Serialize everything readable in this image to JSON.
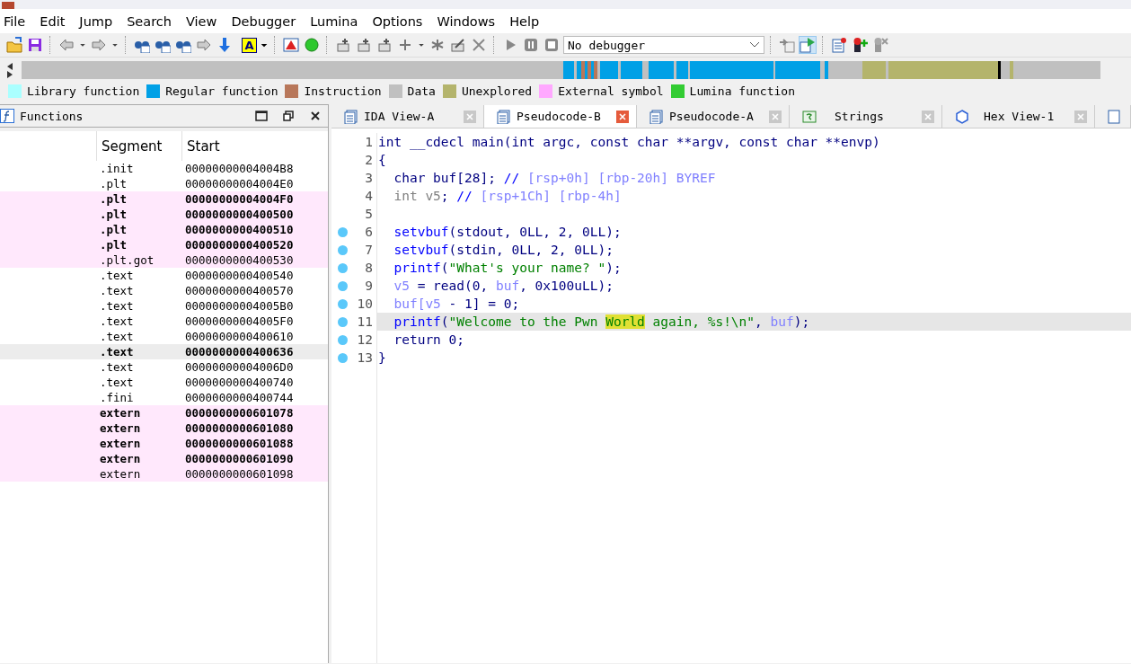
{
  "menu": [
    "File",
    "Edit",
    "Jump",
    "Search",
    "View",
    "Debugger",
    "Lumina",
    "Options",
    "Windows",
    "Help"
  ],
  "toolbar": {
    "text_color_label": "A",
    "debugger_select": "No debugger"
  },
  "legend": [
    {
      "label": "Library function",
      "color": "#aaffff"
    },
    {
      "label": "Regular function",
      "color": "#00a0e6"
    },
    {
      "label": "Instruction",
      "color": "#b8775a"
    },
    {
      "label": "Data",
      "color": "#c0c0c0"
    },
    {
      "label": "Unexplored",
      "color": "#b4b46c"
    },
    {
      "label": "External symbol",
      "color": "#ffa8ff"
    },
    {
      "label": "Lumina function",
      "color": "#33cc33"
    }
  ],
  "functions_panel": {
    "title": "Functions",
    "columns": [
      "Segment",
      "Start"
    ],
    "rows": [
      {
        "segment": ".init",
        "start": "00000000004004B8",
        "bold": false,
        "external": false,
        "selected": false
      },
      {
        "segment": ".plt",
        "start": "00000000004004E0",
        "bold": false,
        "external": false,
        "selected": false
      },
      {
        "segment": ".plt",
        "start": "00000000004004F0",
        "bold": true,
        "external": true,
        "selected": false
      },
      {
        "segment": ".plt",
        "start": "0000000000400500",
        "bold": true,
        "external": true,
        "selected": false
      },
      {
        "segment": ".plt",
        "start": "0000000000400510",
        "bold": true,
        "external": true,
        "selected": false
      },
      {
        "segment": ".plt",
        "start": "0000000000400520",
        "bold": true,
        "external": true,
        "selected": false
      },
      {
        "segment": ".plt.got",
        "start": "0000000000400530",
        "bold": false,
        "external": true,
        "selected": false
      },
      {
        "segment": ".text",
        "start": "0000000000400540",
        "bold": false,
        "external": false,
        "selected": false
      },
      {
        "segment": ".text",
        "start": "0000000000400570",
        "bold": false,
        "external": false,
        "selected": false
      },
      {
        "segment": ".text",
        "start": "00000000004005B0",
        "bold": false,
        "external": false,
        "selected": false
      },
      {
        "segment": ".text",
        "start": "00000000004005F0",
        "bold": false,
        "external": false,
        "selected": false
      },
      {
        "segment": ".text",
        "start": "0000000000400610",
        "bold": false,
        "external": false,
        "selected": false
      },
      {
        "segment": ".text",
        "start": "0000000000400636",
        "bold": true,
        "external": false,
        "selected": true
      },
      {
        "segment": ".text",
        "start": "00000000004006D0",
        "bold": false,
        "external": false,
        "selected": false
      },
      {
        "segment": ".text",
        "start": "0000000000400740",
        "bold": false,
        "external": false,
        "selected": false
      },
      {
        "segment": ".fini",
        "start": "0000000000400744",
        "bold": false,
        "external": false,
        "selected": false
      },
      {
        "segment": "extern",
        "start": "0000000000601078",
        "bold": true,
        "external": true,
        "selected": false
      },
      {
        "segment": "extern",
        "start": "0000000000601080",
        "bold": true,
        "external": true,
        "selected": false
      },
      {
        "segment": "extern",
        "start": "0000000000601088",
        "bold": true,
        "external": true,
        "selected": false
      },
      {
        "segment": "extern",
        "start": "0000000000601090",
        "bold": true,
        "external": true,
        "selected": false
      },
      {
        "segment": "extern",
        "start": "0000000000601098",
        "bold": false,
        "external": true,
        "selected": false
      }
    ]
  },
  "tabs": [
    {
      "label": "IDA View-A",
      "selected": false,
      "kind": "listing"
    },
    {
      "label": "Pseudocode-B",
      "selected": true,
      "kind": "listing"
    },
    {
      "label": "Pseudocode-A",
      "selected": false,
      "kind": "listing"
    },
    {
      "label": "Strings",
      "selected": false,
      "kind": "strings"
    },
    {
      "label": "Hex View-1",
      "selected": false,
      "kind": "hex"
    }
  ],
  "code": [
    {
      "number": "1",
      "breakpoint": false,
      "current": false,
      "tokens": [
        {
          "kind": "plain",
          "text": "int __cdecl main(int argc, const char **argv, const char **envp)"
        }
      ]
    },
    {
      "number": "2",
      "breakpoint": false,
      "current": false,
      "tokens": [
        {
          "kind": "plain",
          "text": "{"
        }
      ]
    },
    {
      "number": "3",
      "breakpoint": false,
      "current": false,
      "tokens": [
        {
          "kind": "plain",
          "text": "  char buf[28]; "
        },
        {
          "kind": "slashes",
          "text": "// "
        },
        {
          "kind": "comment",
          "text": "[rsp+0h] [rbp-20h] BYREF"
        }
      ]
    },
    {
      "number": "4",
      "breakpoint": false,
      "current": false,
      "tokens": [
        {
          "kind": "unused",
          "text": "  int v5"
        },
        {
          "kind": "plain",
          "text": "; "
        },
        {
          "kind": "slashes",
          "text": "// "
        },
        {
          "kind": "comment",
          "text": "[rsp+1Ch] [rbp-4h]"
        }
      ]
    },
    {
      "number": "5",
      "breakpoint": false,
      "current": false
    },
    {
      "number": "6",
      "breakpoint": true,
      "current": false,
      "tokens": [
        {
          "kind": "func",
          "text": "  setvbuf"
        },
        {
          "kind": "plain",
          "text": "(stdout, 0LL, 2, 0LL);"
        }
      ]
    },
    {
      "number": "7",
      "breakpoint": true,
      "current": false,
      "tokens": [
        {
          "kind": "func",
          "text": "  setvbuf"
        },
        {
          "kind": "plain",
          "text": "(stdin, 0LL, 2, 0LL);"
        }
      ]
    },
    {
      "number": "8",
      "breakpoint": true,
      "current": false,
      "tokens": [
        {
          "kind": "func",
          "text": "  printf"
        },
        {
          "kind": "plain",
          "text": "("
        },
        {
          "kind": "string",
          "text": "\"What's your name? \""
        },
        {
          "kind": "plain",
          "text": ");"
        }
      ]
    },
    {
      "number": "9",
      "breakpoint": true,
      "current": false,
      "tokens": [
        {
          "kind": "var",
          "text": "  v5"
        },
        {
          "kind": "plain",
          "text": " = read(0, "
        },
        {
          "kind": "var",
          "text": "buf"
        },
        {
          "kind": "plain",
          "text": ", 0x100uLL);"
        }
      ]
    },
    {
      "number": "10",
      "breakpoint": true,
      "current": false,
      "tokens": [
        {
          "kind": "var",
          "text": "  buf[v5"
        },
        {
          "kind": "plain",
          "text": " - 1] = 0;"
        }
      ]
    },
    {
      "number": "11",
      "breakpoint": true,
      "current": true,
      "tokens": [
        {
          "kind": "func",
          "text": "  printf"
        },
        {
          "kind": "plain",
          "text": "("
        },
        {
          "kind": "string",
          "text": "\"Welcome to the Pwn "
        },
        {
          "kind": "highlight",
          "text": "World"
        },
        {
          "kind": "string",
          "text": " again, %s!\\n\""
        },
        {
          "kind": "plain",
          "text": ", "
        },
        {
          "kind": "var",
          "text": "buf"
        },
        {
          "kind": "plain",
          "text": ");"
        }
      ]
    },
    {
      "number": "12",
      "breakpoint": true,
      "current": false,
      "tokens": [
        {
          "kind": "plain",
          "text": "  return 0;"
        }
      ]
    },
    {
      "number": "13",
      "breakpoint": true,
      "current": false,
      "tokens": [
        {
          "kind": "plain",
          "text": "}"
        }
      ]
    }
  ]
}
